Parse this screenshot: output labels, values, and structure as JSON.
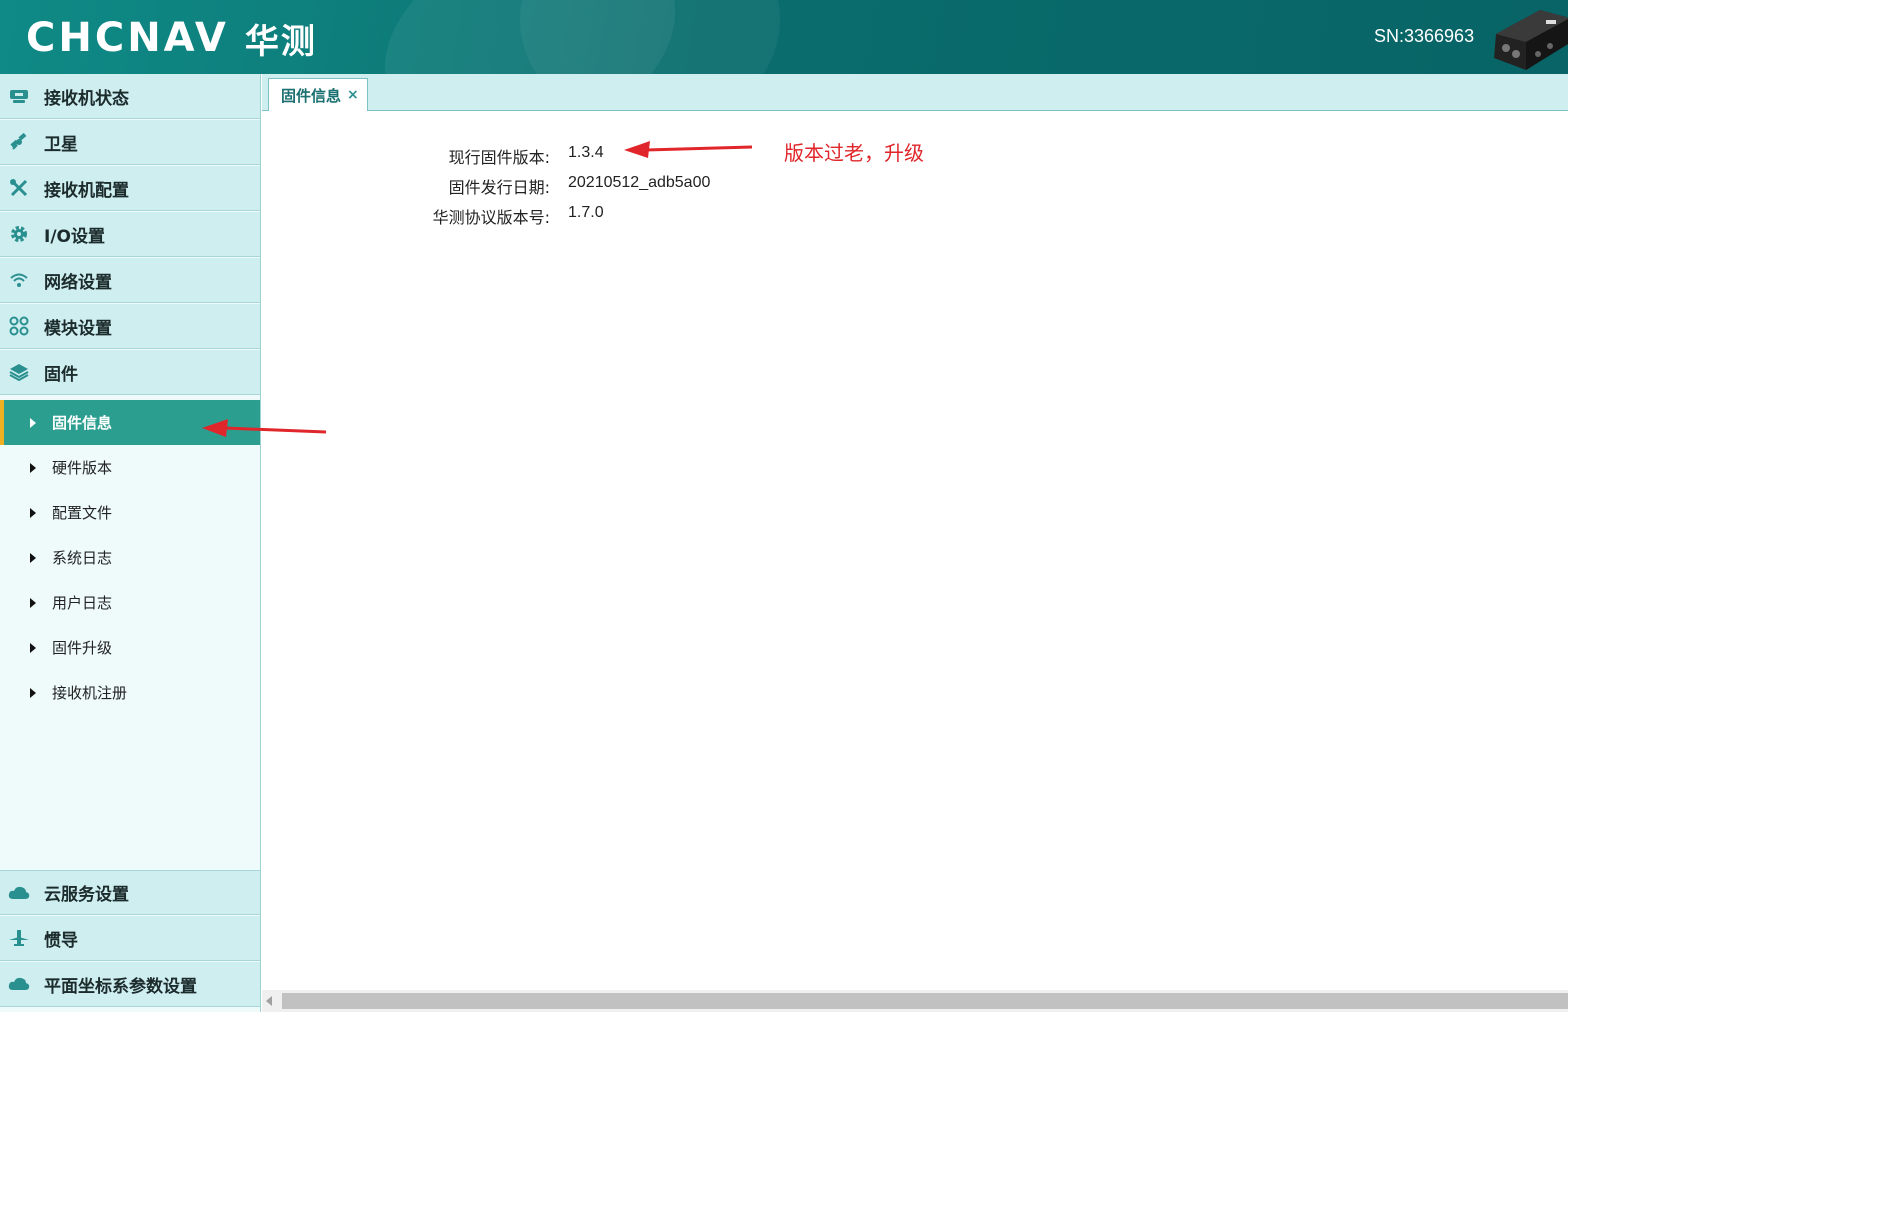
{
  "header": {
    "brand": "CHCNAV",
    "brand_cn": "华测",
    "serial": "SN:3366963"
  },
  "sidebar": {
    "top_items": [
      {
        "label": "接收机状态",
        "icon": "receiver-icon"
      },
      {
        "label": "卫星",
        "icon": "satellite-icon"
      },
      {
        "label": "接收机配置",
        "icon": "tools-icon"
      },
      {
        "label": "I/O设置",
        "icon": "gear-icon"
      },
      {
        "label": "网络设置",
        "icon": "wifi-icon"
      },
      {
        "label": "模块设置",
        "icon": "modules-icon"
      },
      {
        "label": "固件",
        "icon": "layers-icon"
      }
    ],
    "sub_items": [
      {
        "label": "固件信息",
        "active": true
      },
      {
        "label": "硬件版本"
      },
      {
        "label": "配置文件"
      },
      {
        "label": "系统日志"
      },
      {
        "label": "用户日志"
      },
      {
        "label": "固件升级"
      },
      {
        "label": "接收机注册"
      }
    ],
    "bottom_items": [
      {
        "label": "云服务设置",
        "icon": "cloud-icon"
      },
      {
        "label": "惯导",
        "icon": "ins-icon"
      },
      {
        "label": "平面坐标系参数设置",
        "icon": "cloud-icon"
      }
    ]
  },
  "tabs": [
    {
      "label": "固件信息",
      "close": "×"
    }
  ],
  "firmware_info": {
    "current_version_label": "现行固件版本:",
    "current_version": "1.3.4",
    "release_date_label": "固件发行日期:",
    "release_date": "20210512_adb5a00",
    "protocol_version_label": "华测协议版本号:",
    "protocol_version": "1.7.0"
  },
  "annotation": {
    "text": "版本过老，升级",
    "color": "#e0262a"
  },
  "colors": {
    "header": "#0a6d6d",
    "menu_bg": "#cfeef0",
    "active_item": "#2c9e90",
    "active_marker": "#f0b024"
  }
}
